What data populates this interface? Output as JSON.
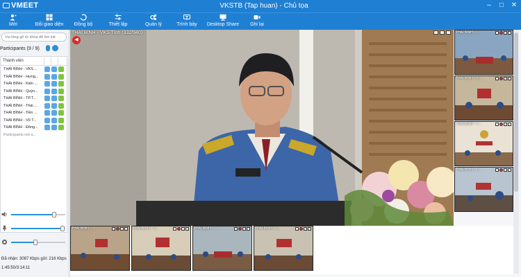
{
  "app": {
    "logo": "VMEET",
    "window_title": "VKSTB (Tap huan) - Chủ tọa"
  },
  "window_controls": [
    "–",
    "□",
    "✕"
  ],
  "toolbar": [
    {
      "label": "Mời",
      "icon": "invite-icon"
    },
    {
      "label": "Đổi giao diện",
      "icon": "layout-icon"
    },
    {
      "label": "Đồng bộ",
      "icon": "sync-icon"
    },
    {
      "label": "Thiết lập",
      "icon": "settings-sliders-icon"
    },
    {
      "label": "Quản lý",
      "icon": "manage-icon"
    },
    {
      "label": "Trình bày",
      "icon": "present-icon"
    },
    {
      "label": "Desktop Share",
      "icon": "desktop-share-icon"
    },
    {
      "label": "Ghi lại",
      "icon": "record-icon"
    }
  ],
  "left": {
    "search_placeholder": "Vui lòng gõ từ khóa để tìm kiế",
    "participants_title": "Participants (9 / 9)",
    "list_header": "Thành viên",
    "participants": [
      "THÁI BÌNH - VKS ...",
      "THÁI BÌNH - Hưng...",
      "THÁI BÌNH - Kiến ...",
      "THÁI BÌNH - Quỳn...",
      "THÁI BÌNH - TP.T...",
      "THÁI BÌNH - Thái ...",
      "THÁI BÌNH - Tiền ...",
      "THÁI BÌNH - Vũ T...",
      "THÁI BÌNH - Đông..."
    ],
    "not_added_note": "Participants not a...",
    "speaker_volume": 0.8,
    "mic_volume": 0.95,
    "camera_level": 0.45,
    "stats": "Đã nhận: 3087 Kbps gửi: 216 Kbps",
    "timer": "1:45:50/3:14:11"
  },
  "main_video": {
    "label": "THÁI BÌNH - VKS Tỉnh (332/940)"
  },
  "right_thumbs": [
    {
      "label": "THÁI BÌNH - ..."
    },
    {
      "label": "THÁI BÌNH - V..."
    },
    {
      "label": "THÁI BÌNH - T..."
    },
    {
      "label": "THÁI BÌNH - T..."
    }
  ],
  "bottom_thumbs": [
    {
      "label": "THÁI BÌNH - ..."
    },
    {
      "label": "THÁI BÌNH - T..."
    },
    {
      "label": "THÁI BÌNH - ..."
    },
    {
      "label": "THÁI BÌNH - T..."
    }
  ]
}
